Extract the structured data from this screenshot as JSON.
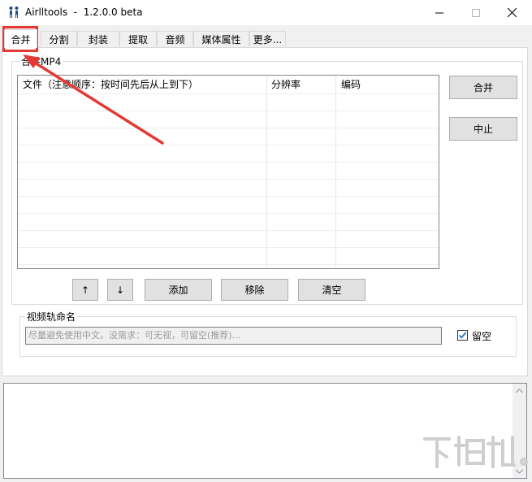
{
  "window": {
    "title": "Airlltools  -  1.2.0.0 beta",
    "controls": [
      "minimize-icon",
      "maximize-icon",
      "close-icon"
    ]
  },
  "tabs": [
    {
      "label": "合并",
      "active": true
    },
    {
      "label": "分割"
    },
    {
      "label": "封装"
    },
    {
      "label": "提取"
    },
    {
      "label": "音频"
    },
    {
      "label": "媒体属性"
    },
    {
      "label": "更多..."
    }
  ],
  "merge": {
    "group_label": "合并MP4",
    "columns": [
      "文件（注意顺序：按时间先后从上到下）",
      "分辨率",
      "编码"
    ],
    "rows": [],
    "buttons": {
      "merge": "合并",
      "stop": "中止",
      "up": "↑",
      "down": "↓",
      "add": "添加",
      "remove": "移除",
      "clear": "清空"
    }
  },
  "video_track": {
    "group_label": "视频轨命名",
    "placeholder": "尽量避免使用中文。没需求：可无视，可留空(推荐)...",
    "checkbox_label": "留空",
    "checkbox_checked": true
  },
  "colors": {
    "annotation": "#e53935",
    "checkbox_check": "#1e74c9"
  }
}
